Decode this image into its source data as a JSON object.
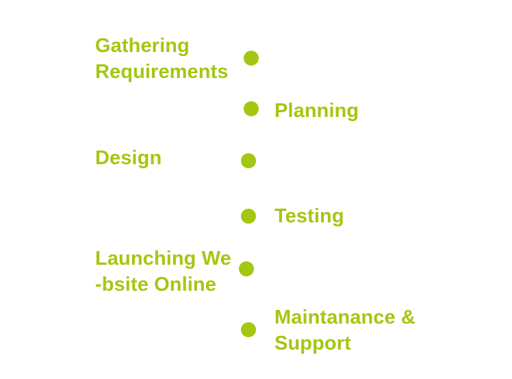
{
  "timeline": {
    "accent_color": "#a4c711",
    "steps": [
      {
        "side": "left",
        "lines": [
          "Gathering",
          "Requirements"
        ]
      },
      {
        "side": "right",
        "lines": [
          "Planning"
        ]
      },
      {
        "side": "left",
        "lines": [
          "Design"
        ]
      },
      {
        "side": "right",
        "lines": [
          "Testing"
        ]
      },
      {
        "side": "left",
        "lines": [
          "Launching We",
          "-bsite Online"
        ]
      },
      {
        "side": "right",
        "lines": [
          "Maintanance &",
          "Support"
        ]
      }
    ]
  }
}
